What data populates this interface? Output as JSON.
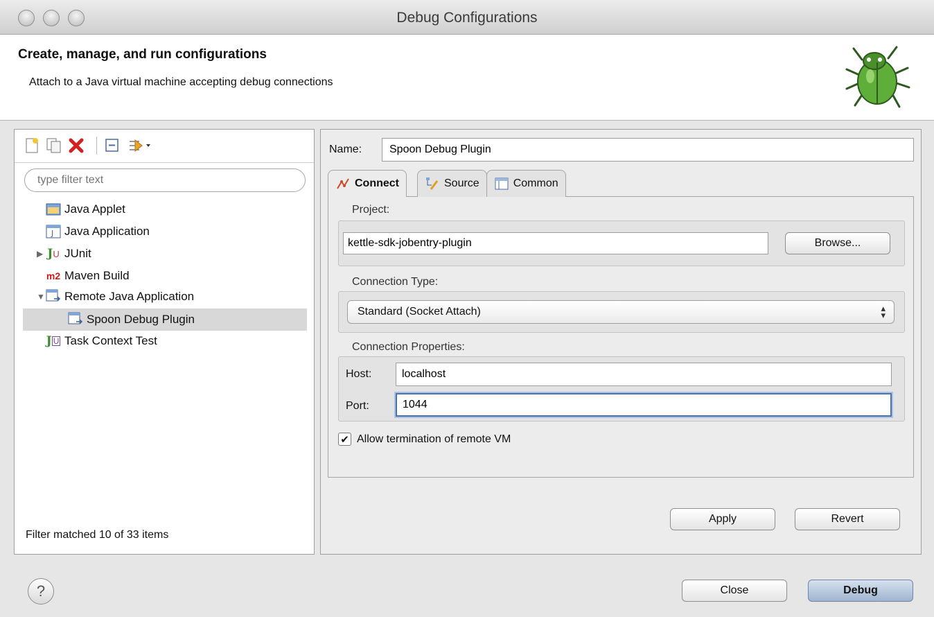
{
  "window": {
    "title": "Debug Configurations"
  },
  "header": {
    "title": "Create, manage, and run configurations",
    "subtitle": "Attach to a Java virtual machine accepting debug connections",
    "banner_icon": "bug-icon"
  },
  "left": {
    "toolbar": [
      "new-configuration-icon",
      "duplicate-icon",
      "delete-icon",
      "collapse-all-icon",
      "filter-icon"
    ],
    "filter_placeholder": "type filter text",
    "tree": [
      {
        "label": "Java Applet",
        "icon": "java-applet-icon"
      },
      {
        "label": "Java Application",
        "icon": "java-application-icon"
      },
      {
        "label": "JUnit",
        "icon": "junit-icon",
        "expanded": false
      },
      {
        "label": "Maven Build",
        "icon": "maven-icon",
        "icon_text": "m2"
      },
      {
        "label": "Remote Java Application",
        "icon": "remote-java-icon",
        "expanded": true
      },
      {
        "label": "Spoon Debug Plugin",
        "icon": "remote-java-icon",
        "selected": true
      },
      {
        "label": "Task Context Test",
        "icon": "task-context-icon"
      }
    ],
    "status": "Filter matched 10 of 33 items"
  },
  "right": {
    "name_label": "Name:",
    "name_value": "Spoon Debug Plugin",
    "tabs": [
      {
        "label": "Connect",
        "icon": "connect-icon",
        "active": true
      },
      {
        "label": "Source",
        "icon": "source-icon",
        "active": false
      },
      {
        "label": "Common",
        "icon": "common-icon",
        "active": false
      }
    ],
    "project": {
      "label": "Project:",
      "value": "kettle-sdk-jobentry-plugin",
      "browse": "Browse..."
    },
    "connection_type": {
      "label": "Connection Type:",
      "selected": "Standard (Socket Attach)"
    },
    "connection_properties": {
      "label": "Connection Properties:",
      "host_label": "Host:",
      "host_value": "localhost",
      "port_label": "Port:",
      "port_value": "1044"
    },
    "allow_termination": {
      "label": "Allow termination of remote VM",
      "checked": true
    },
    "apply": "Apply",
    "revert": "Revert"
  },
  "footer": {
    "help": "?",
    "close": "Close",
    "debug": "Debug"
  },
  "colors": {
    "selection": "#d8d8d8",
    "focus": "#4a72b0",
    "delete_red": "#d62020",
    "maven_red": "#d01818"
  }
}
